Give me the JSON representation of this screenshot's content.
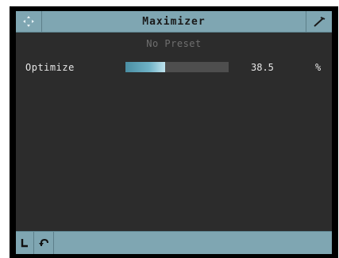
{
  "plugin": {
    "title": "Maximizer",
    "preset": "No Preset"
  },
  "parameters": [
    {
      "label": "Optimize",
      "value": "38.5",
      "unit": "%",
      "level": 0.385
    }
  ],
  "icons": {
    "move": "move-arrows-icon",
    "settings": "wrench-icon",
    "bottom_left": "link-icon",
    "bottom_undo": "undo-icon"
  },
  "colors": {
    "titlebar": "#7fa6b2",
    "background": "#2c2c2c",
    "slider_fill": "#6fb2c6",
    "slider_track": "#4e4e4e"
  }
}
